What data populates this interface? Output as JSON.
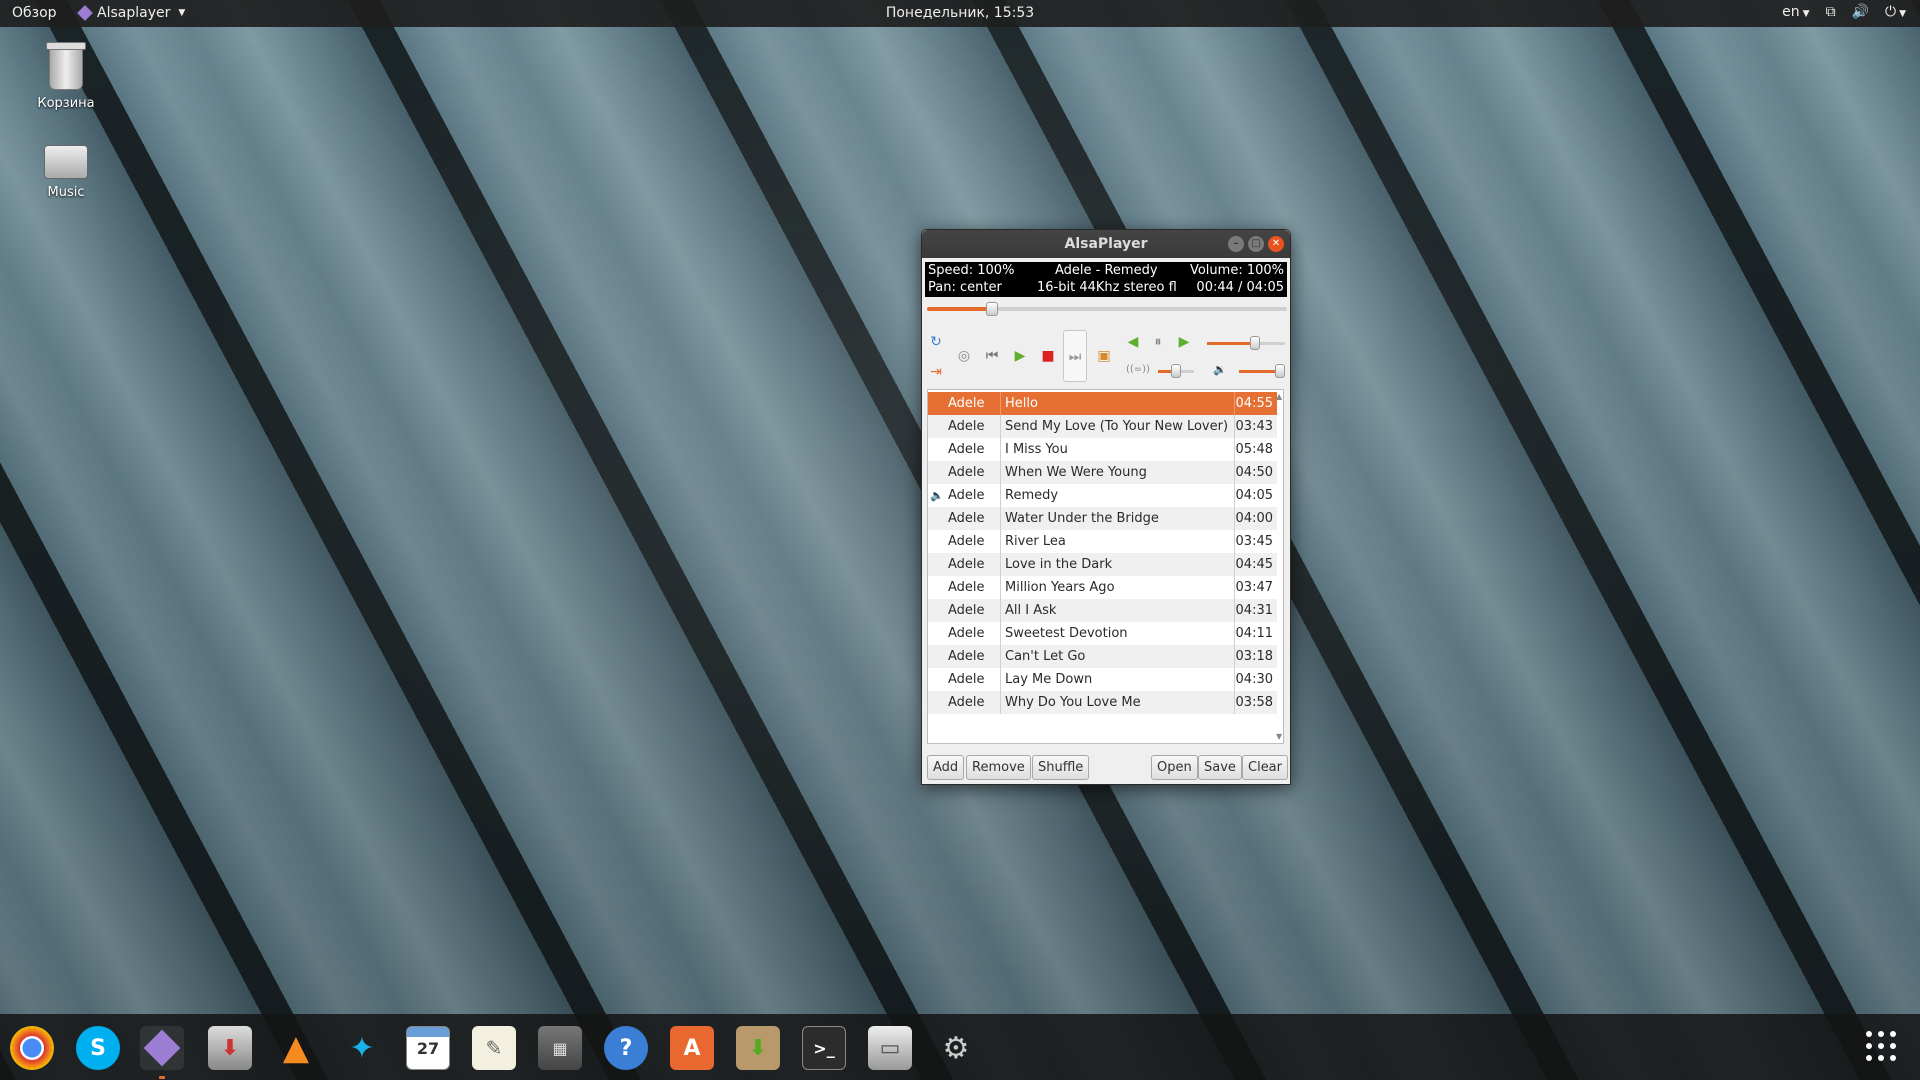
{
  "topbar": {
    "overview": "Обзор",
    "app_name": "Alsaplayer",
    "clock": "Понедельник, 15:53",
    "lang": "en"
  },
  "desktop": {
    "trash": "Корзина",
    "music": "Music"
  },
  "window": {
    "title": "AlsaPlayer",
    "info": {
      "speed": "Speed: 100%",
      "track": "Adele - Remedy",
      "volume": "Volume: 100%",
      "pan": "Pan: center",
      "format": "16-bit 44Khz stereo fl",
      "time": "00:44 / 04:05"
    },
    "seek_fraction": 0.18,
    "playlist": [
      {
        "artist": "Adele",
        "title": "Hello",
        "duration": "04:55",
        "selected": true
      },
      {
        "artist": "Adele",
        "title": "Send My Love (To Your New Lover)",
        "duration": "03:43"
      },
      {
        "artist": "Adele",
        "title": "I Miss You",
        "duration": "05:48"
      },
      {
        "artist": "Adele",
        "title": "When We Were Young",
        "duration": "04:50"
      },
      {
        "artist": "Adele",
        "title": "Remedy",
        "duration": "04:05",
        "playing": true
      },
      {
        "artist": "Adele",
        "title": "Water Under the Bridge",
        "duration": "04:00"
      },
      {
        "artist": "Adele",
        "title": "River Lea",
        "duration": "03:45"
      },
      {
        "artist": "Adele",
        "title": "Love in the Dark",
        "duration": "04:45"
      },
      {
        "artist": "Adele",
        "title": "Million Years Ago",
        "duration": "03:47"
      },
      {
        "artist": "Adele",
        "title": "All I Ask",
        "duration": "04:31"
      },
      {
        "artist": "Adele",
        "title": "Sweetest Devotion",
        "duration": "04:11"
      },
      {
        "artist": "Adele",
        "title": "Can't Let Go",
        "duration": "03:18"
      },
      {
        "artist": "Adele",
        "title": "Lay Me Down",
        "duration": "04:30"
      },
      {
        "artist": "Adele",
        "title": "Why Do You Love Me",
        "duration": "03:58"
      }
    ],
    "buttons": {
      "add": "Add",
      "remove": "Remove",
      "shuffle": "Shuffle",
      "open": "Open",
      "save": "Save",
      "clear": "Clear"
    }
  },
  "dock": {
    "items": [
      "chrome-icon",
      "skype-icon",
      "alsaplayer-icon",
      "installer-icon",
      "vlc-icon",
      "kodi-icon",
      "calendar-icon",
      "text-editor-icon",
      "calculator-icon",
      "help-icon",
      "software-center-icon",
      "archive-manager-icon",
      "terminal-icon",
      "file-manager-icon",
      "settings-icon"
    ],
    "calendar_day": "27"
  },
  "colors": {
    "accent": "#e66f33",
    "close": "#e9541f"
  }
}
